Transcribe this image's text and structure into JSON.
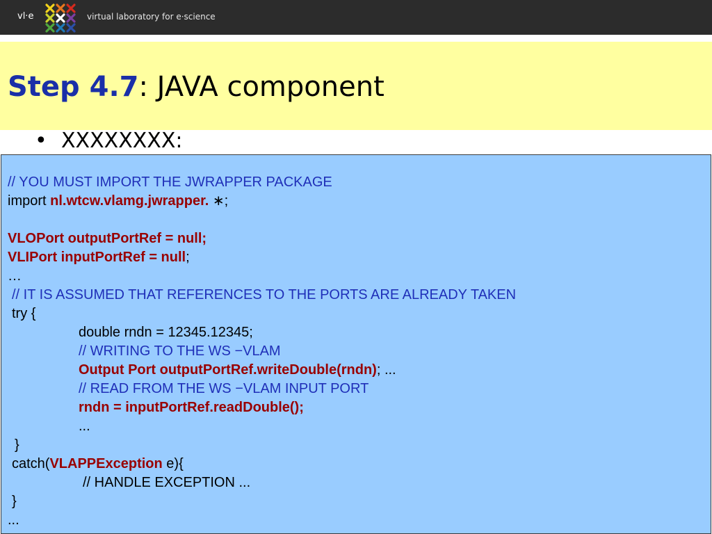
{
  "header": {
    "brand_short": "vl·e",
    "brand_long": "virtual laboratory for e·science",
    "logo_icon": "vle-colored-crosses-logo",
    "logo_colors": [
      "#f2d21b",
      "#e8761e",
      "#d42a1e",
      "#c9d22b",
      "#ffffff",
      "#7b3fa0",
      "#4fa83d",
      "#1f7ab8",
      "#2b4fa8"
    ]
  },
  "title": {
    "step": "Step 4.7",
    "rest": ": JAVA component"
  },
  "bullet": {
    "text": "XXXXXXXX:"
  },
  "code": {
    "l01": "// YOU MUST IMPORT THE JWRAPPER PACKAGE",
    "l02a": "import ",
    "l02b": "nl.wtcw.vlamg.jwrapper. ",
    "l02c": "∗;",
    "l04": "VLOPort outputPortRef = null;",
    "l05a": "VLIPort inputPortRef = null",
    "l05b": ";",
    "l06": "…",
    "l07": "// IT IS ASSUMED THAT REFERENCES TO THE PORTS ARE ALREADY TAKEN",
    "l08": "try {",
    "l09": "double rndn = 12345.12345;",
    "l10": "// WRITING TO THE WS −VLAM",
    "l11a": "Output Port outputPortRef.writeDouble(rndn)",
    "l11b": "; ...",
    "l12": "// READ FROM THE WS −VLAM INPUT PORT",
    "l13": "rndn = inputPortRef.readDouble();",
    "l14": "...",
    "l15": "}",
    "l16a": "catch(",
    "l16b": "VLAPPException",
    "l16c": " e){",
    "l17": "// HANDLE EXCEPTION ...",
    "l18": "}",
    "l19": "..."
  }
}
